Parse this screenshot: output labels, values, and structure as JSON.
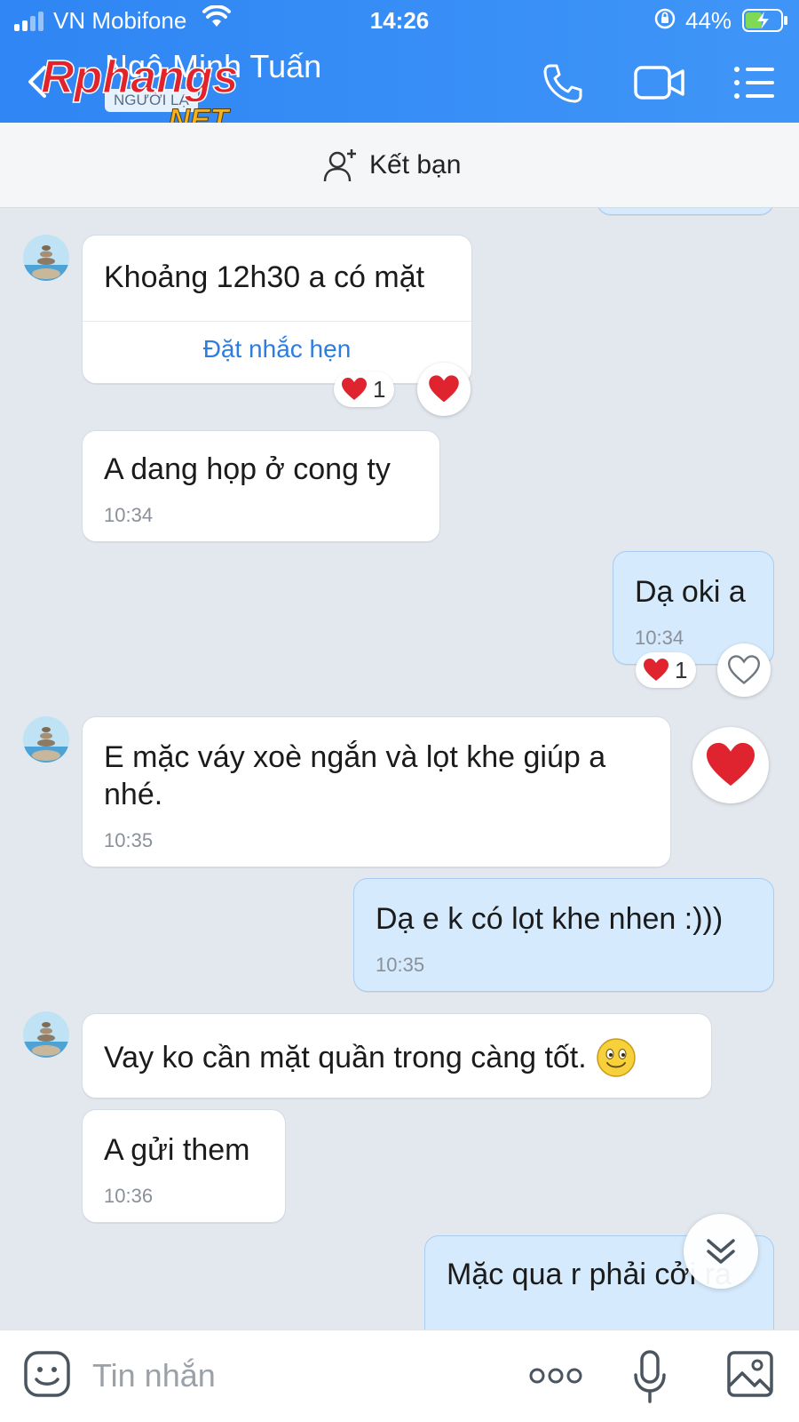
{
  "status_bar": {
    "carrier": "VN Mobifone",
    "time": "14:26",
    "battery_percent": "44%"
  },
  "header": {
    "contact_name": "Ngô Minh Tuấn",
    "stranger_label": "NGƯỜI LẠ",
    "watermark_text": "Rphangs.NET",
    "accent_color": "#3a8ff5"
  },
  "add_friend": {
    "label": "Kết bạn"
  },
  "messages": [
    {
      "direction": "in",
      "text": "Khoảng 12h30 a có mặt",
      "action": "Đặt nhắc hẹn",
      "reaction_count": "1"
    },
    {
      "direction": "in",
      "text": "A dang họp ở cong ty",
      "time": "10:34"
    },
    {
      "direction": "out",
      "text": "Dạ oki a",
      "time": "10:34",
      "reaction_count": "1"
    },
    {
      "direction": "in",
      "text": "E mặc váy xoè ngắn và lọt khe giúp a nhé.",
      "time": "10:35"
    },
    {
      "direction": "out",
      "text": "Dạ e k có lọt khe nhen :)))",
      "time": "10:35"
    },
    {
      "direction": "in",
      "text": "Vay ko cần mặt quần trong càng tốt.",
      "emoji": "smiley-emoji"
    },
    {
      "direction": "in",
      "text": "A gửi them",
      "time": "10:36"
    },
    {
      "direction": "out",
      "text": "Mặc qua r phải cởi ra"
    }
  ],
  "composer": {
    "placeholder": "Tin nhắn"
  },
  "colors": {
    "header_blue": "#3a8ff5",
    "outgoing_bubble": "#d5eafc",
    "incoming_bubble": "#ffffff",
    "chat_bg": "#e3e8ef",
    "heart": "#e0242f",
    "link_blue": "#2c7de0"
  }
}
